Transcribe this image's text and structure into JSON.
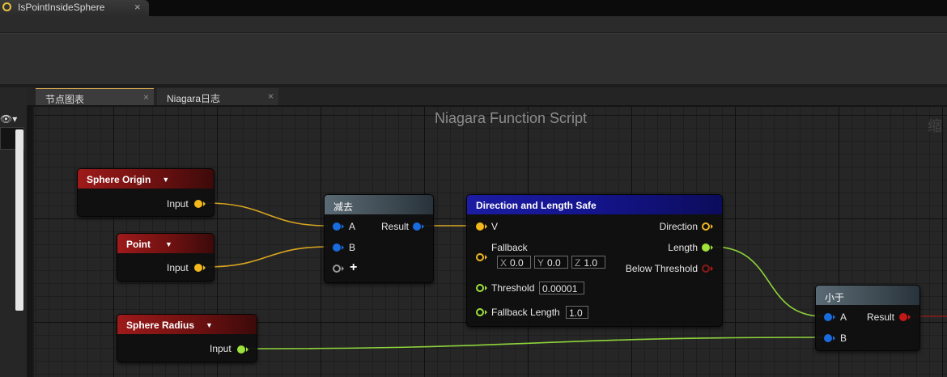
{
  "document_tab": {
    "title": "IsPointInsideSphere",
    "close": "×"
  },
  "editor_tabs": [
    {
      "label": "节点图表",
      "close": "×"
    },
    {
      "label": "Niagara日志",
      "close": "×"
    }
  ],
  "graph": {
    "title": "Niagara Function Script",
    "zoom_label": "缩"
  },
  "nodes": {
    "sphere_origin": {
      "title": "Sphere Origin",
      "arrow": "▼",
      "output_label": "Input"
    },
    "point": {
      "title": "Point",
      "arrow": "▼",
      "output_label": "Input"
    },
    "sphere_radius": {
      "title": "Sphere Radius",
      "arrow": "▼",
      "output_label": "Input"
    },
    "subtract": {
      "title": "减去",
      "input_a": "A",
      "input_b": "B",
      "add_pin": "+",
      "output_label": "Result"
    },
    "direction_length": {
      "title": "Direction and Length Safe",
      "input_v": "V",
      "fallback_label": "Fallback",
      "fallback": {
        "x_axis": "X",
        "x": "0.0",
        "y_axis": "Y",
        "y": "0.0",
        "z_axis": "Z",
        "z": "1.0"
      },
      "threshold_label": "Threshold",
      "threshold_value": "0.00001",
      "fallback_length_label": "Fallback Length",
      "fallback_length_value": "1.0",
      "out_direction": "Direction",
      "out_length": "Length",
      "out_below_threshold": "Below Threshold"
    },
    "less_than": {
      "title": "小于",
      "input_a": "A",
      "input_b": "B",
      "output_label": "Result"
    }
  },
  "colors": {
    "vector_pin": "#f2b81c",
    "float_pin": "#9ee23a",
    "bool_pin": "#c41818",
    "numeric_pin": "#1a6cde",
    "parameter_header": "#9e1a1a",
    "function_header": "#1c1ca4",
    "operator_header": "#5a6a74"
  }
}
